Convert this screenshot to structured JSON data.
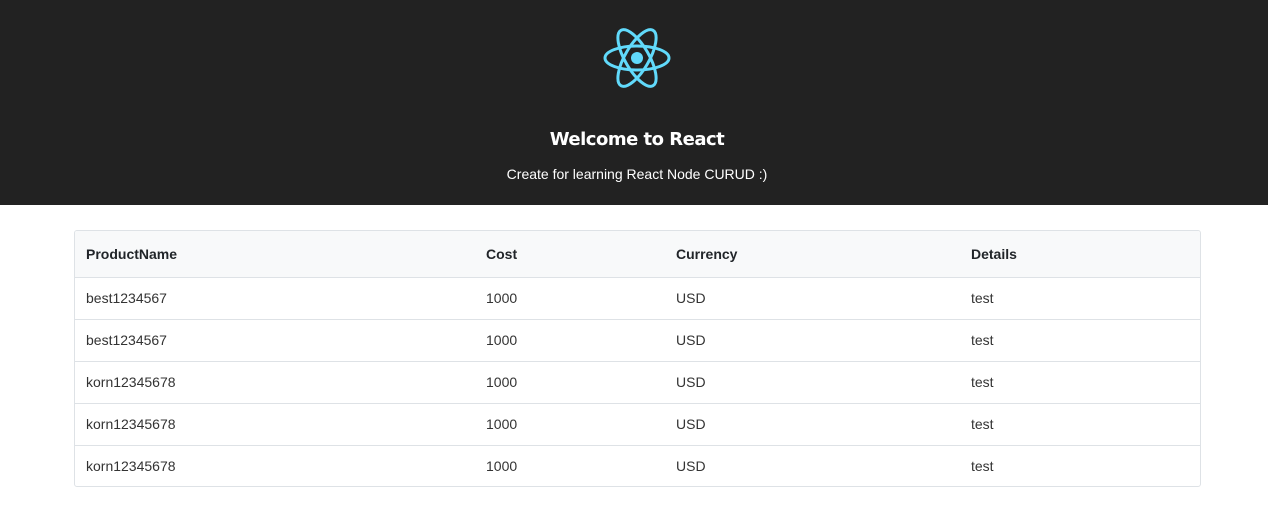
{
  "header": {
    "logo_icon": "react-logo-icon",
    "logo_color": "#61dafb",
    "background": "#222222",
    "title": "Welcome to React",
    "subtitle": "Create for learning React Node CURUD :)"
  },
  "table": {
    "columns": [
      "ProductName",
      "Cost",
      "Currency",
      "Details"
    ],
    "rows": [
      [
        "best1234567",
        "1000",
        "USD",
        "test"
      ],
      [
        "best1234567",
        "1000",
        "USD",
        "test"
      ],
      [
        "korn12345678",
        "1000",
        "USD",
        "test"
      ],
      [
        "korn12345678",
        "1000",
        "USD",
        "test"
      ],
      [
        "korn12345678",
        "1000",
        "USD",
        "test"
      ]
    ]
  }
}
